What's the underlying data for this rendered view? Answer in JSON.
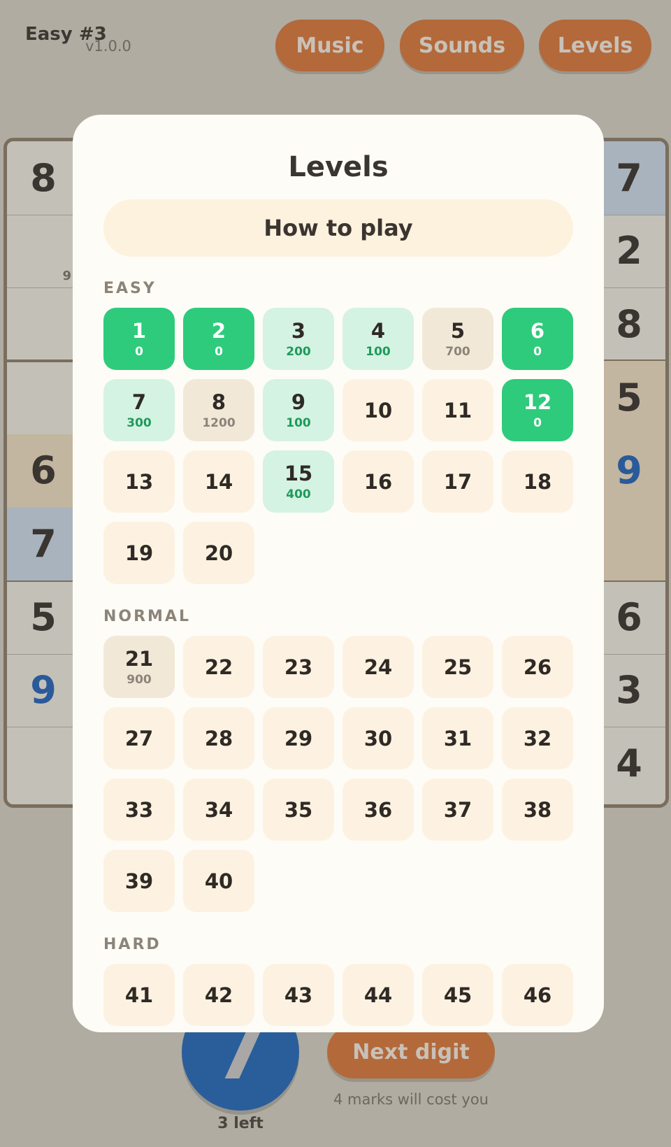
{
  "header": {
    "game_label": "Easy #3",
    "version": "v1.0.0",
    "buttons": {
      "music": "Music",
      "sounds": "Sounds",
      "levels": "Levels"
    }
  },
  "board": {
    "left_column": [
      "8",
      "",
      "",
      "",
      "6",
      "7",
      "5",
      "9",
      ""
    ],
    "right_column": [
      "7",
      "2",
      "8",
      "5",
      "9",
      "",
      "6",
      "3",
      "4"
    ],
    "left_note": "9",
    "blue_digits": [
      "9"
    ]
  },
  "bottom": {
    "current_digit": "7",
    "digits_left": "3 left",
    "next_button": "Next digit",
    "cost_text": "4 marks will cost you"
  },
  "modal": {
    "title": "Levels",
    "how_to_play": "How to play",
    "sections": [
      {
        "label": "EASY",
        "levels": [
          {
            "n": "1",
            "score": "0",
            "status": "complete"
          },
          {
            "n": "2",
            "score": "0",
            "status": "complete"
          },
          {
            "n": "3",
            "score": "200",
            "status": "partial"
          },
          {
            "n": "4",
            "score": "100",
            "status": "partial"
          },
          {
            "n": "5",
            "score": "700",
            "status": "visited"
          },
          {
            "n": "6",
            "score": "0",
            "status": "complete"
          },
          {
            "n": "7",
            "score": "300",
            "status": "partial"
          },
          {
            "n": "8",
            "score": "1200",
            "status": "visited"
          },
          {
            "n": "9",
            "score": "100",
            "status": "partial"
          },
          {
            "n": "10",
            "score": "",
            "status": "locked"
          },
          {
            "n": "11",
            "score": "",
            "status": "locked"
          },
          {
            "n": "12",
            "score": "0",
            "status": "complete"
          },
          {
            "n": "13",
            "score": "",
            "status": "locked"
          },
          {
            "n": "14",
            "score": "",
            "status": "locked"
          },
          {
            "n": "15",
            "score": "400",
            "status": "partial"
          },
          {
            "n": "16",
            "score": "",
            "status": "locked"
          },
          {
            "n": "17",
            "score": "",
            "status": "locked"
          },
          {
            "n": "18",
            "score": "",
            "status": "locked"
          },
          {
            "n": "19",
            "score": "",
            "status": "locked"
          },
          {
            "n": "20",
            "score": "",
            "status": "locked"
          }
        ]
      },
      {
        "label": "NORMAL",
        "levels": [
          {
            "n": "21",
            "score": "900",
            "status": "visited"
          },
          {
            "n": "22",
            "score": "",
            "status": "locked"
          },
          {
            "n": "23",
            "score": "",
            "status": "locked"
          },
          {
            "n": "24",
            "score": "",
            "status": "locked"
          },
          {
            "n": "25",
            "score": "",
            "status": "locked"
          },
          {
            "n": "26",
            "score": "",
            "status": "locked"
          },
          {
            "n": "27",
            "score": "",
            "status": "locked"
          },
          {
            "n": "28",
            "score": "",
            "status": "locked"
          },
          {
            "n": "29",
            "score": "",
            "status": "locked"
          },
          {
            "n": "30",
            "score": "",
            "status": "locked"
          },
          {
            "n": "31",
            "score": "",
            "status": "locked"
          },
          {
            "n": "32",
            "score": "",
            "status": "locked"
          },
          {
            "n": "33",
            "score": "",
            "status": "locked"
          },
          {
            "n": "34",
            "score": "",
            "status": "locked"
          },
          {
            "n": "35",
            "score": "",
            "status": "locked"
          },
          {
            "n": "36",
            "score": "",
            "status": "locked"
          },
          {
            "n": "37",
            "score": "",
            "status": "locked"
          },
          {
            "n": "38",
            "score": "",
            "status": "locked"
          },
          {
            "n": "39",
            "score": "",
            "status": "locked"
          },
          {
            "n": "40",
            "score": "",
            "status": "locked"
          }
        ]
      },
      {
        "label": "HARD",
        "levels": [
          {
            "n": "41",
            "score": "",
            "status": "locked"
          },
          {
            "n": "42",
            "score": "",
            "status": "locked"
          },
          {
            "n": "43",
            "score": "",
            "status": "locked"
          },
          {
            "n": "44",
            "score": "",
            "status": "locked"
          },
          {
            "n": "45",
            "score": "",
            "status": "locked"
          },
          {
            "n": "46",
            "score": "",
            "status": "locked"
          }
        ]
      }
    ]
  },
  "colors": {
    "complete": "#2ecb7c",
    "partial": "#d4f3e2",
    "visited": "#f1e8d8",
    "default_tile": "#fdf2e1",
    "accent_button": "#b3693a",
    "digit_blue": "#2a5e9b"
  }
}
